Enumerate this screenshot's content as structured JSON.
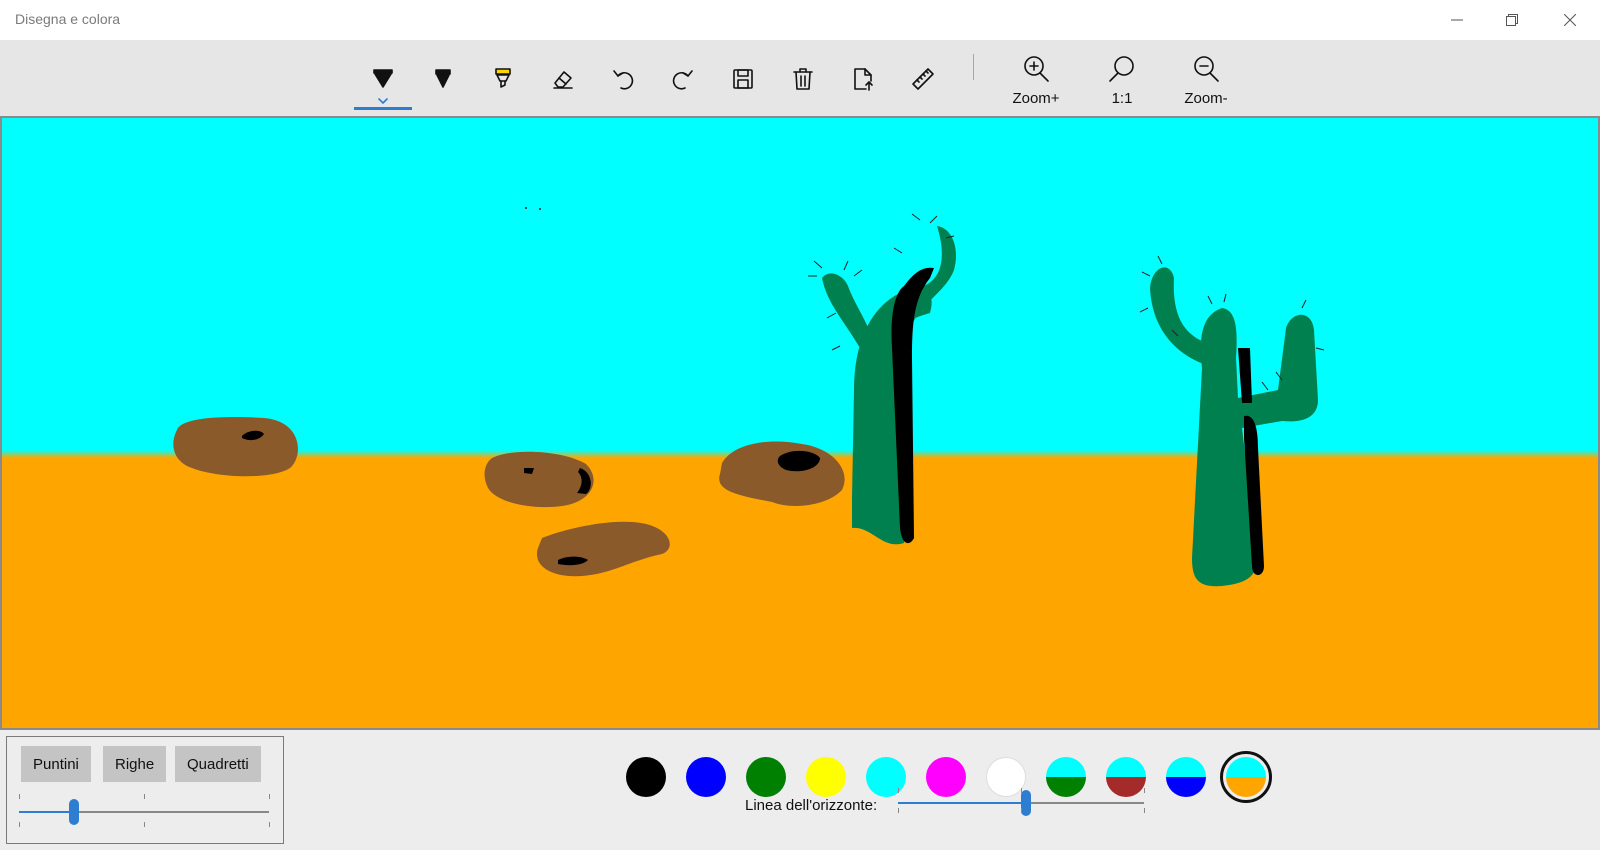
{
  "window": {
    "title": "Disegna e colora"
  },
  "toolbar": {
    "tools": [
      "pen-icon",
      "pencil-icon",
      "highlighter-icon",
      "eraser-icon",
      "undo-icon",
      "redo-icon",
      "save-icon",
      "delete-icon",
      "export-icon",
      "ruler-icon"
    ],
    "zoom_in_label": "Zoom+",
    "zoom_reset_label": "1:1",
    "zoom_out_label": "Zoom-"
  },
  "grid": {
    "dots_label": "Puntini",
    "lines_label": "Righe",
    "squares_label": "Quadretti",
    "density": 0.22
  },
  "palette": {
    "colors": [
      "#000000",
      "#0000ff",
      "#008000",
      "#ffff00",
      "#00ffff",
      "#ff00ff",
      "#ffffff"
    ],
    "backgrounds": [
      {
        "top": "#00ffff",
        "bottom": "#008000"
      },
      {
        "top": "#00ffff",
        "bottom": "#a52a2a"
      },
      {
        "top": "#00ffff",
        "bottom": "#0000ff"
      },
      {
        "top": "#00ffff",
        "bottom": "#ffa500"
      }
    ],
    "selected_background": 3
  },
  "horizon": {
    "label": "Linea dell'orizzonte:",
    "value": 0.52
  },
  "colors": {
    "sky": "#00ffff",
    "ground": "#ffa500",
    "accent": "#2f7dd1",
    "rock": "#8b5a2b",
    "cactus": "#00804f"
  }
}
